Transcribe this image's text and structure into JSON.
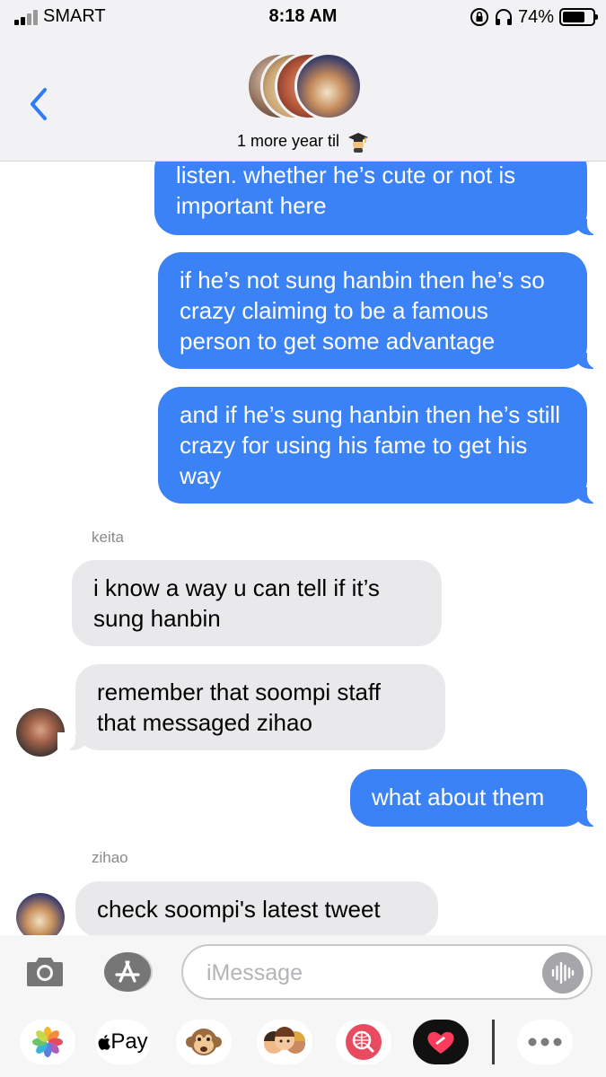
{
  "status": {
    "carrier": "SMART",
    "time": "8:18 AM",
    "battery_text": "74%",
    "battery_level": 0.74
  },
  "conversation": {
    "title": "1 more year til",
    "title_emoji": "graduation-cap-emoji"
  },
  "messages": [
    {
      "type": "sent",
      "text": "listen. whether he’s cute or not is important here"
    },
    {
      "type": "sent",
      "text": "if he’s not sung hanbin then he’s so crazy claiming to be a famous person to get some advantage"
    },
    {
      "type": "sent",
      "text": "and if he’s sung hanbin then he’s still crazy for using his fame to get his way"
    },
    {
      "type": "received",
      "sender": "keita",
      "text": "i know a way u can tell if it’s sung hanbin"
    },
    {
      "type": "received",
      "text": "remember that soompi staff that messaged zihao"
    },
    {
      "type": "sent",
      "text": "what about them"
    },
    {
      "type": "received",
      "sender": "zihao",
      "text": "check soompi's latest tweet"
    }
  ],
  "compose": {
    "placeholder": "iMessage"
  },
  "apps": [
    {
      "name": "photos-icon"
    },
    {
      "name": "apple-pay-icon",
      "label": "Pay"
    },
    {
      "name": "monkey-memoji-icon"
    },
    {
      "name": "memoji-stickers-icon"
    },
    {
      "name": "web-search-icon"
    },
    {
      "name": "digital-touch-icon"
    },
    {
      "name": "more-apps-icon"
    }
  ],
  "colors": {
    "sent_bubble": "#3a82f6",
    "received_bubble": "#e9e9eb",
    "accent": "#2f7cf6"
  }
}
